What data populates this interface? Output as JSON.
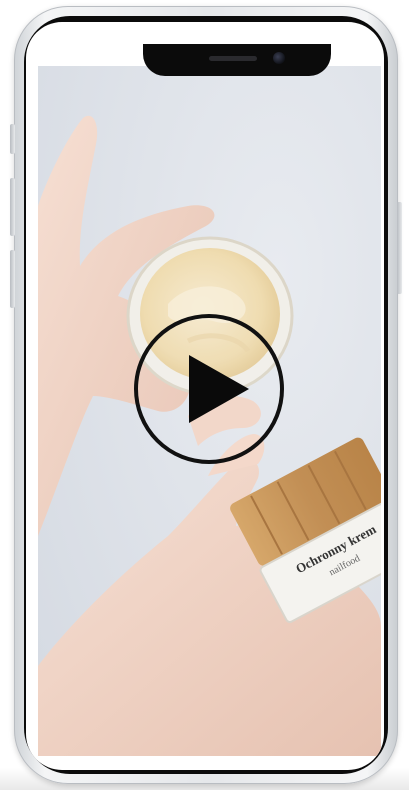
{
  "player": {
    "play_button_icon": "play-icon",
    "state": "paused"
  },
  "video": {
    "scene": "hands holding open cream jar and bamboo-lid jar",
    "jar_label_title": "Ochronny krem",
    "jar_label_brand": "nailfood"
  },
  "colors": {
    "background": "#e2e6ec",
    "skin": "#efd3c6",
    "cream": "#f3e3bd",
    "bamboo": "#c9975c",
    "frame": "#0b0b0b"
  }
}
